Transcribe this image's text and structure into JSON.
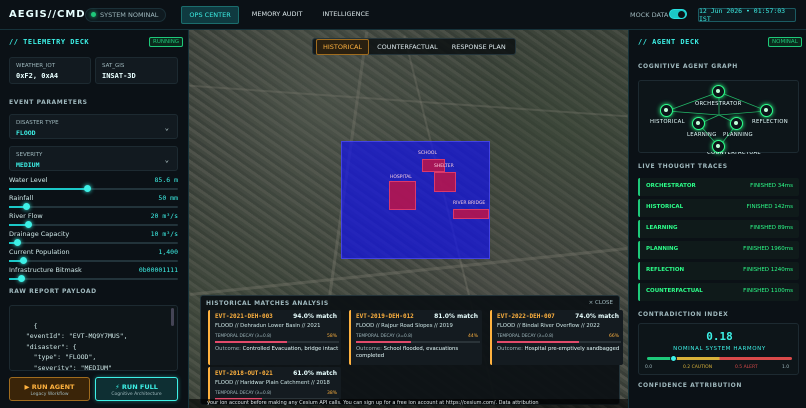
{
  "app": {
    "brand": "AEGIS//CMD",
    "system_status": "SYSTEM NOMINAL"
  },
  "nav": {
    "tabs": [
      {
        "label": "OPS CENTER",
        "active": true
      },
      {
        "label": "MEMORY AUDIT",
        "active": false
      },
      {
        "label": "INTELLIGENCE",
        "active": false
      }
    ]
  },
  "header": {
    "mock_label": "MOCK DATA",
    "mock_on": true,
    "datetime": "12 Jun 2026 • 01:57:03 IST"
  },
  "telemetry": {
    "title": "// TELEMETRY DECK",
    "status": "RUNNING",
    "weather_label": "WEATHER_IOT",
    "weather_value": "0xF2, 0xA4",
    "sat_label": "SAT_GIS",
    "sat_value": "INSAT-3D",
    "event_params": "EVENT PARAMETERS",
    "disaster_label": "DISASTER TYPE",
    "disaster_value": "FLOOD",
    "severity_label": "SEVERITY",
    "severity_value": "MEDIUM",
    "sliders": [
      {
        "name": "Water Level",
        "value": "85.6 m",
        "level": 0.46
      },
      {
        "name": "Rainfall",
        "value": "50 mm",
        "level": 0.1
      },
      {
        "name": "River Flow",
        "value": "20 m³/s",
        "level": 0.11
      },
      {
        "name": "Drainage Capacity",
        "value": "10 m³/s",
        "level": 0.05
      },
      {
        "name": "Current Population",
        "value": "1,400",
        "level": 0.08
      },
      {
        "name": "Infrastructure Bitmask",
        "value": "0b00001111",
        "level": 0.07
      }
    ],
    "raw_title": "RAW REPORT PAYLOAD",
    "raw_payload": "{\n  \"eventId\": \"EVT-MQ9Y7MUS\",\n  \"disaster\": {\n    \"type\": \"FLOOD\",\n    \"severity\": \"MEDIUM\"\n  },\n  \"environment\": {",
    "run_agent": "▶ RUN AGENT",
    "run_agent_sub": "Legacy Workflow",
    "run_full": "⚡ RUN FULL",
    "run_full_sub": "Cognitive Architecture"
  },
  "view": {
    "tabs": [
      {
        "label": "HISTORICAL",
        "active": true
      },
      {
        "label": "COUNTERFACTUAL",
        "active": false
      },
      {
        "label": "RESPONSE PLAN",
        "active": false
      }
    ],
    "buildings": [
      {
        "label": "HOSPITAL"
      },
      {
        "label": "SCHOOL"
      },
      {
        "label": "RIVER BRIDGE"
      },
      {
        "label": "SHELTER"
      }
    ]
  },
  "history": {
    "title": "HISTORICAL MATCHES ANALYSIS",
    "close": "× CLOSE",
    "decay_label": "TEMPORAL DECAY (λ=0.8)",
    "outcome_label": "Outcome:",
    "matches": [
      {
        "id": "EVT-2021-DEH-003",
        "match": "94.0% match",
        "loc": "FLOOD // Dehradun Lower Basin // 2021",
        "decay": "58%",
        "decay_level": 0.58,
        "outcome": "Controlled Evacuation, bridge intact"
      },
      {
        "id": "EVT-2019-DEH-012",
        "match": "81.0% match",
        "loc": "FLOOD // Rajpur Road Slopes // 2019",
        "decay": "44%",
        "decay_level": 0.44,
        "outcome": "School flooded, evacuations completed"
      },
      {
        "id": "EVT-2022-DEH-007",
        "match": "74.0% match",
        "loc": "FLOOD // Bindal River Overflow // 2022",
        "decay": "66%",
        "decay_level": 0.66,
        "outcome": "Hospital pre-emptively sandbagged"
      },
      {
        "id": "EVT-2018-OUT-021",
        "match": "61.0% match",
        "loc": "FLOOD // Haridwar Plain Catchment // 2018",
        "decay": "38%",
        "decay_level": 0.38,
        "outcome": ""
      }
    ]
  },
  "cesium_note": "your ion account before making any Cesium API calls. You can sign up for a free ion account at https://cesium.com/.  Data attribution",
  "agent": {
    "title": "// AGENT DECK",
    "status": "NOMINAL",
    "graph_title": "COGNITIVE AGENT GRAPH",
    "nodes": [
      "ORCHESTRATOR",
      "HISTORICAL",
      "REFLECTION",
      "LEARNING",
      "PLANNING",
      "COUNTERFACTUAL"
    ],
    "traces_title": "LIVE THOUGHT TRACES",
    "traces": [
      {
        "name": "ORCHESTRATOR",
        "status": "FINISHED 34ms"
      },
      {
        "name": "HISTORICAL",
        "status": "FINISHED 142ms"
      },
      {
        "name": "LEARNING",
        "status": "FINISHED 89ms"
      },
      {
        "name": "PLANNING",
        "status": "FINISHED 1960ms"
      },
      {
        "name": "REFLECTION",
        "status": "FINISHED 1240ms"
      },
      {
        "name": "COUNTERFACTUAL",
        "status": "FINISHED 1100ms"
      }
    ],
    "contradiction_title": "CONTRADICTION INDEX",
    "contradiction_value": "0.18",
    "harmony": "NOMINAL SYSTEM HARMONY",
    "scale": [
      "0.0",
      "0.2 CAUTION",
      "0.5 ALERT",
      "1.0"
    ],
    "confidence_title": "CONFIDENCE ATTRIBUTION"
  },
  "colors": {
    "accent": "#3df0e6",
    "amber": "#ffb23f",
    "green": "#2cff8a",
    "flood": "#1414e6",
    "alert": "#e24a6a"
  }
}
